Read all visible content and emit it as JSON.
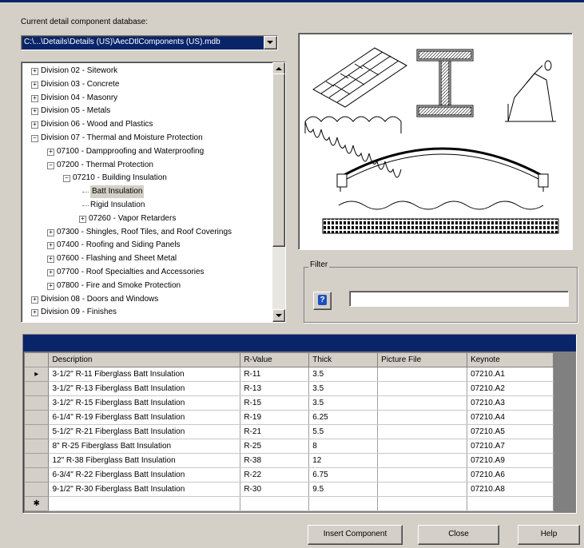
{
  "dialog": {
    "db_label": "Current detail component database:",
    "db_path": "C:\\...\\Details\\Details (US)\\AecDtlComponents (US).mdb"
  },
  "tree": {
    "items": [
      {
        "label": "Division 02 - Sitework",
        "expander": "+"
      },
      {
        "label": "Division 03 - Concrete",
        "expander": "+"
      },
      {
        "label": "Division 04 - Masonry",
        "expander": "+"
      },
      {
        "label": "Division 05 - Metals",
        "expander": "+"
      },
      {
        "label": "Division 06 - Wood and Plastics",
        "expander": "+"
      },
      {
        "label": "Division 07 - Thermal and Moisture Protection",
        "expander": "−"
      },
      {
        "label": "07100 - Dampproofing and Waterproofing",
        "expander": "+"
      },
      {
        "label": "07200 - Thermal Protection",
        "expander": "−"
      },
      {
        "label": "07210 - Building Insulation",
        "expander": "−"
      },
      {
        "label": "Batt Insulation",
        "expander": ""
      },
      {
        "label": "Rigid Insulation",
        "expander": ""
      },
      {
        "label": "07260 - Vapor Retarders",
        "expander": "+"
      },
      {
        "label": "07300 - Shingles, Roof Tiles, and Roof Coverings",
        "expander": "+"
      },
      {
        "label": "07400 - Roofing and Siding Panels",
        "expander": "+"
      },
      {
        "label": "07600 - Flashing and Sheet Metal",
        "expander": "+"
      },
      {
        "label": "07700 - Roof Specialties and Accessories",
        "expander": "+"
      },
      {
        "label": "07800 - Fire and Smoke Protection",
        "expander": "+"
      },
      {
        "label": "Division 08 - Doors and Windows",
        "expander": "+"
      },
      {
        "label": "Division 09 - Finishes",
        "expander": "+"
      }
    ],
    "selected": "Batt Insulation"
  },
  "filter": {
    "label": "Filter",
    "value": "",
    "help_icon": "?"
  },
  "grid": {
    "columns": [
      "Description",
      "R-Value",
      "Thick",
      "Picture File",
      "Keynote"
    ],
    "rows": [
      [
        "3-1/2\" R-11 Fiberglass Batt Insulation",
        "R-11",
        "3.5",
        "",
        "07210.A1"
      ],
      [
        "3-1/2\" R-13 Fiberglass Batt Insulation",
        "R-13",
        "3.5",
        "",
        "07210.A2"
      ],
      [
        "3-1/2\" R-15 Fiberglass Batt Insulation",
        "R-15",
        "3.5",
        "",
        "07210.A3"
      ],
      [
        "6-1/4\" R-19 Fiberglass Batt Insulation",
        "R-19",
        "6.25",
        "",
        "07210.A4"
      ],
      [
        "5-1/2\" R-21 Fiberglass Batt Insulation",
        "R-21",
        "5.5",
        "",
        "07210.A5"
      ],
      [
        "8\" R-25 Fiberglass Batt Insulation",
        "R-25",
        "8",
        "",
        "07210.A7"
      ],
      [
        "12\" R-38 Fiberglass Batt Insulation",
        "R-38",
        "12",
        "",
        "07210.A9"
      ],
      [
        "6-3/4\" R-22 Fiberglass Batt Insulation",
        "R-22",
        "6.75",
        "",
        "07210.A6"
      ],
      [
        "9-1/2\" R-30 Fiberglass Batt Insulation",
        "R-30",
        "9.5",
        "",
        "07210.A8"
      ]
    ],
    "current_row_marker": "▸",
    "new_row_marker": "✱"
  },
  "buttons": {
    "insert": "Insert Component",
    "close": "Close",
    "help": "Help"
  }
}
